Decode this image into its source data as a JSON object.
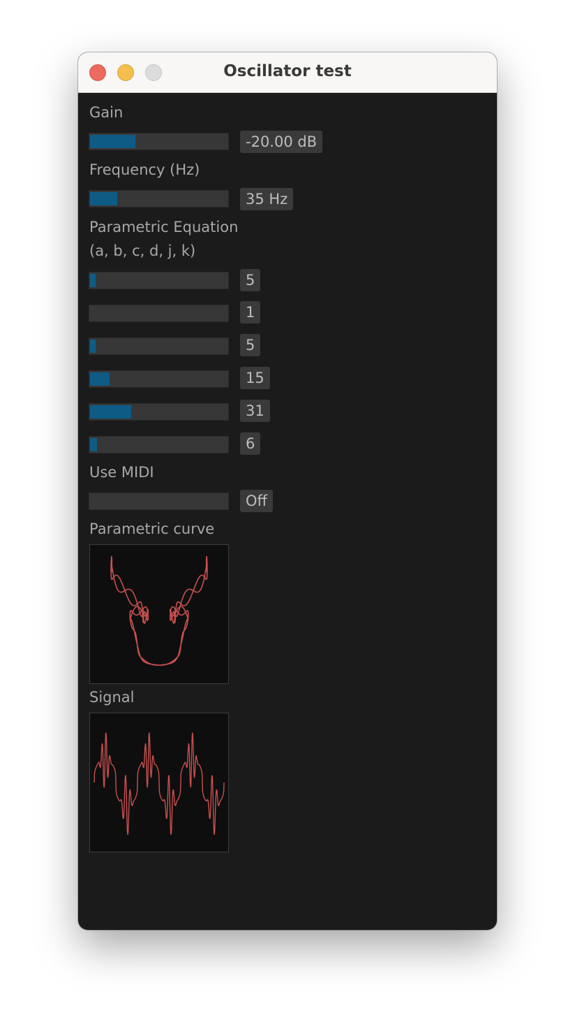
{
  "window": {
    "title": "Oscillator test"
  },
  "controls": {
    "gain": {
      "label": "Gain",
      "value": "-20.00 dB",
      "level": 0.33
    },
    "frequency": {
      "label": "Frequency (Hz)",
      "value": "35 Hz",
      "level": 0.2
    },
    "parametric": {
      "label_line1": "Parametric Equation",
      "label_line2": "(a, b, c, d, j, k)",
      "params": [
        {
          "value": "5",
          "level": 0.04
        },
        {
          "value": "1",
          "level": 0.0
        },
        {
          "value": "5",
          "level": 0.04
        },
        {
          "value": "15",
          "level": 0.14
        },
        {
          "value": "31",
          "level": 0.3
        },
        {
          "value": "6",
          "level": 0.05
        }
      ]
    },
    "midi": {
      "label": "Use MIDI",
      "value": "Off",
      "level": 0.0
    }
  },
  "displays": {
    "curve_label": "Parametric curve",
    "signal_label": "Signal"
  },
  "colors": {
    "accent": "#0e5c86",
    "trace": "#c7504f",
    "background": "#1b1b1b"
  }
}
